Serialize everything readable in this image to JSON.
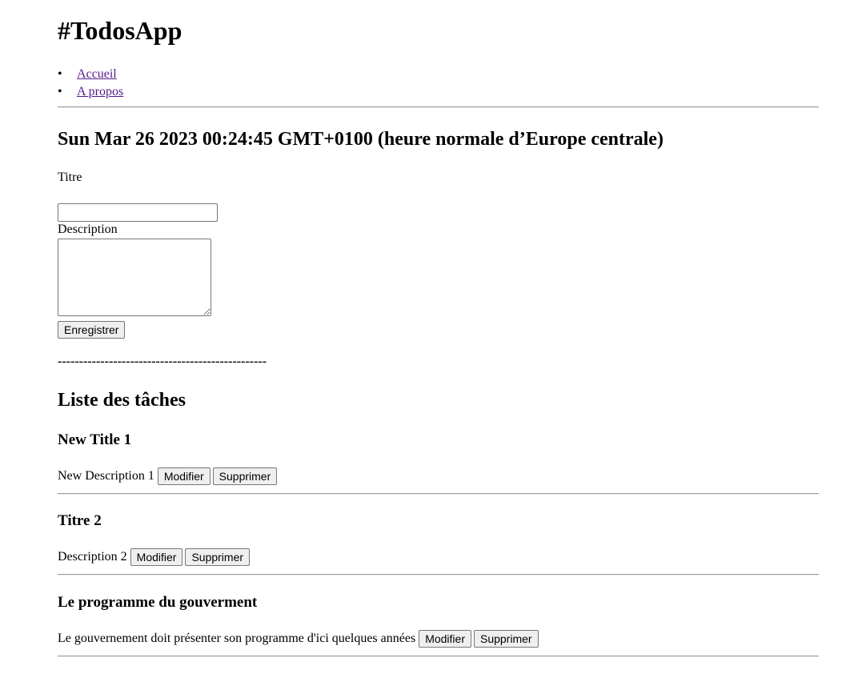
{
  "app": {
    "title": "#TodosApp"
  },
  "nav": {
    "items": [
      {
        "label": "Accueil"
      },
      {
        "label": "A propos"
      }
    ]
  },
  "header": {
    "date": "Sun Mar 26 2023 00:24:45 GMT+0100 (heure normale d’Europe centrale)"
  },
  "form": {
    "title_label": "Titre",
    "title_value": "",
    "description_label": "Description",
    "description_value": "",
    "save_label": "Enregistrer"
  },
  "separator": "-------------------------------------------------",
  "list": {
    "heading": "Liste des tâches",
    "todos": [
      {
        "title": "New Title 1",
        "description": "New Description 1",
        "edit_label": "Modifier",
        "delete_label": "Supprimer"
      },
      {
        "title": "Titre 2",
        "description": "Description 2",
        "edit_label": "Modifier",
        "delete_label": "Supprimer"
      },
      {
        "title": "Le programme du gouverment",
        "description": "Le gouvernement doit présenter son programme d'ici quelques années",
        "edit_label": "Modifier",
        "delete_label": "Supprimer"
      }
    ]
  }
}
